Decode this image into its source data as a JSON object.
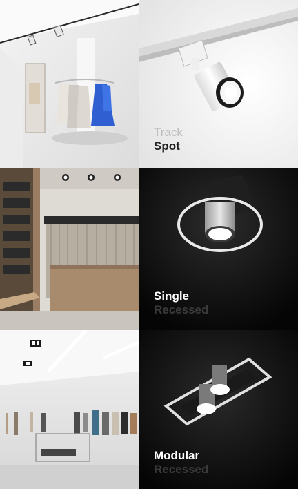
{
  "tiles": [
    {
      "line1": "Track",
      "line2": "Spot",
      "line1_color": "#bdbdbd",
      "line2_color": "#222222"
    },
    {
      "line1": "Single",
      "line2": "Recessed",
      "line1_color": "#ffffff",
      "line2_color": "#3a3a3a"
    },
    {
      "line1": "Modular",
      "line2": "Recessed",
      "line1_color": "#ffffff",
      "line2_color": "#3a3a3a"
    }
  ],
  "colors": {
    "dress_blue": "#2f5fd0",
    "wood": "#a88a6c"
  }
}
